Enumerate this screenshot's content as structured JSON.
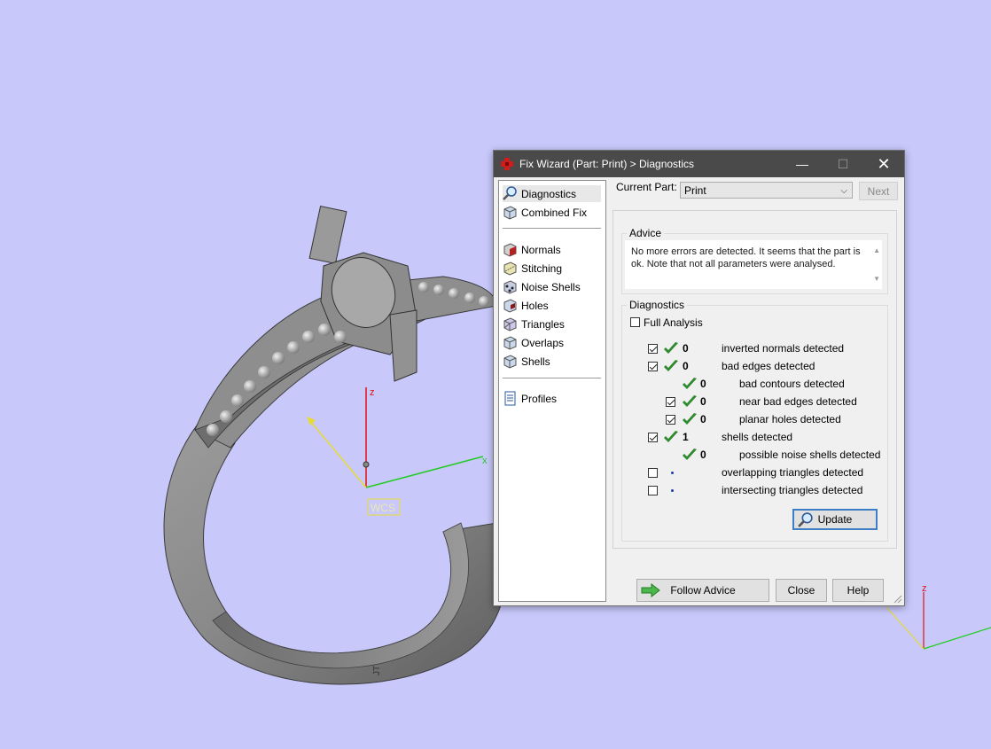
{
  "viewport": {
    "background": "#c8c8fa",
    "axis_labels": {
      "z": "z",
      "x": "x",
      "wcs": "WCS",
      "z2": "z"
    },
    "engraving": "JT"
  },
  "dialog": {
    "title": "Fix Wizard (Part: Print) > Diagnostics",
    "titlebar_buttons": {
      "minimize": "—",
      "maximize": "☐",
      "close": "✕"
    },
    "nav": {
      "items": [
        {
          "label": "Diagnostics",
          "icon": "magnifier-icon",
          "selected": true
        },
        {
          "label": "Combined Fix",
          "icon": "cube-icon"
        },
        {
          "label": "Normals",
          "icon": "normals-cube-icon"
        },
        {
          "label": "Stitching",
          "icon": "stitching-icon"
        },
        {
          "label": "Noise Shells",
          "icon": "noise-shells-icon"
        },
        {
          "label": "Holes",
          "icon": "holes-icon"
        },
        {
          "label": "Triangles",
          "icon": "triangles-icon"
        },
        {
          "label": "Overlaps",
          "icon": "overlaps-icon"
        },
        {
          "label": "Shells",
          "icon": "shells-icon"
        },
        {
          "label": "Profiles",
          "icon": "document-icon"
        }
      ]
    },
    "current_part": {
      "label": "Current Part:",
      "value": "Print"
    },
    "next_label": "Next",
    "advice": {
      "title": "Advice",
      "text": "No more errors are detected. It seems that the part is ok. Note that not all parameters were analysed."
    },
    "diagnostics": {
      "title": "Diagnostics",
      "full_analysis": {
        "label": "Full Analysis",
        "checked": false
      },
      "rows": [
        {
          "checkbox": true,
          "checked": true,
          "status": "ok",
          "count": "0",
          "label": "inverted normals detected"
        },
        {
          "checkbox": true,
          "checked": true,
          "status": "ok",
          "count": "0",
          "label": "bad edges detected"
        },
        {
          "checkbox": false,
          "checked": false,
          "status": "ok",
          "count": "0",
          "label": "bad contours detected"
        },
        {
          "checkbox": true,
          "checked": true,
          "status": "ok",
          "count": "0",
          "label": "near bad edges detected"
        },
        {
          "checkbox": true,
          "checked": true,
          "status": "ok",
          "count": "0",
          "label": "planar holes detected"
        },
        {
          "checkbox": true,
          "checked": true,
          "status": "ok",
          "count": "1",
          "label": "shells detected"
        },
        {
          "checkbox": false,
          "checked": false,
          "status": "ok",
          "count": "0",
          "label": "possible noise shells detected"
        },
        {
          "checkbox": true,
          "checked": false,
          "status": "none",
          "count": "",
          "label": "overlapping triangles detected"
        },
        {
          "checkbox": true,
          "checked": false,
          "status": "none",
          "count": "",
          "label": "intersecting triangles detected"
        }
      ],
      "update_label": "Update"
    },
    "buttons": {
      "follow_advice": "Follow Advice",
      "close": "Close",
      "help": "Help"
    }
  }
}
